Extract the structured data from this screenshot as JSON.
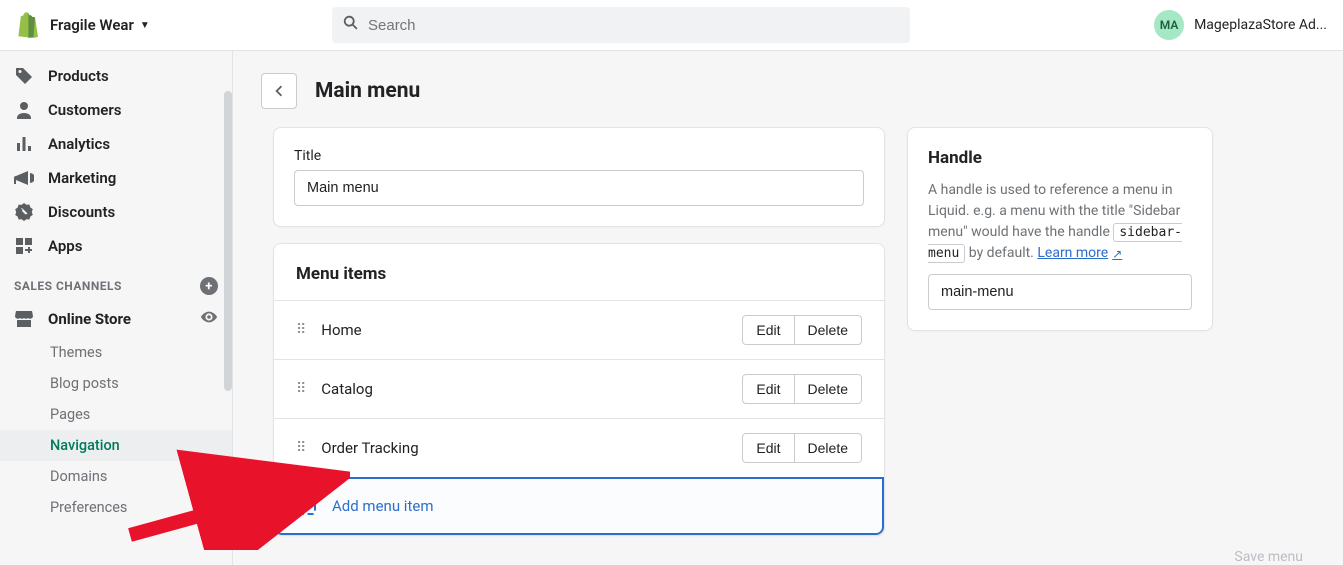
{
  "header": {
    "store_name": "Fragile Wear",
    "search_placeholder": "Search",
    "avatar_initials": "MA",
    "user_name": "MageplazaStore Ad..."
  },
  "sidebar": {
    "items": [
      {
        "label": "Products",
        "icon": "tag"
      },
      {
        "label": "Customers",
        "icon": "person"
      },
      {
        "label": "Analytics",
        "icon": "bars"
      },
      {
        "label": "Marketing",
        "icon": "horn"
      },
      {
        "label": "Discounts",
        "icon": "badge"
      },
      {
        "label": "Apps",
        "icon": "grid"
      }
    ],
    "section_title": "SALES CHANNELS",
    "store_item": "Online Store",
    "sub_items": [
      "Themes",
      "Blog posts",
      "Pages",
      "Navigation",
      "Domains",
      "Preferences"
    ],
    "active_sub": "Navigation"
  },
  "page": {
    "title": "Main menu",
    "title_label": "Title",
    "title_value": "Main menu",
    "menu_items_heading": "Menu items",
    "items": [
      {
        "label": "Home"
      },
      {
        "label": "Catalog"
      },
      {
        "label": "Order Tracking"
      }
    ],
    "edit_label": "Edit",
    "delete_label": "Delete",
    "add_item_label": "Add menu item"
  },
  "handle_card": {
    "heading": "Handle",
    "desc_prefix": "A handle is used to reference a menu in Liquid. e.g. a menu with the title \"Sidebar menu\" would have the handle ",
    "code": "sidebar-menu",
    "desc_suffix": " by default.",
    "learn_more": "Learn more",
    "value": "main-menu"
  },
  "footer": {
    "save_label": "Save menu"
  }
}
